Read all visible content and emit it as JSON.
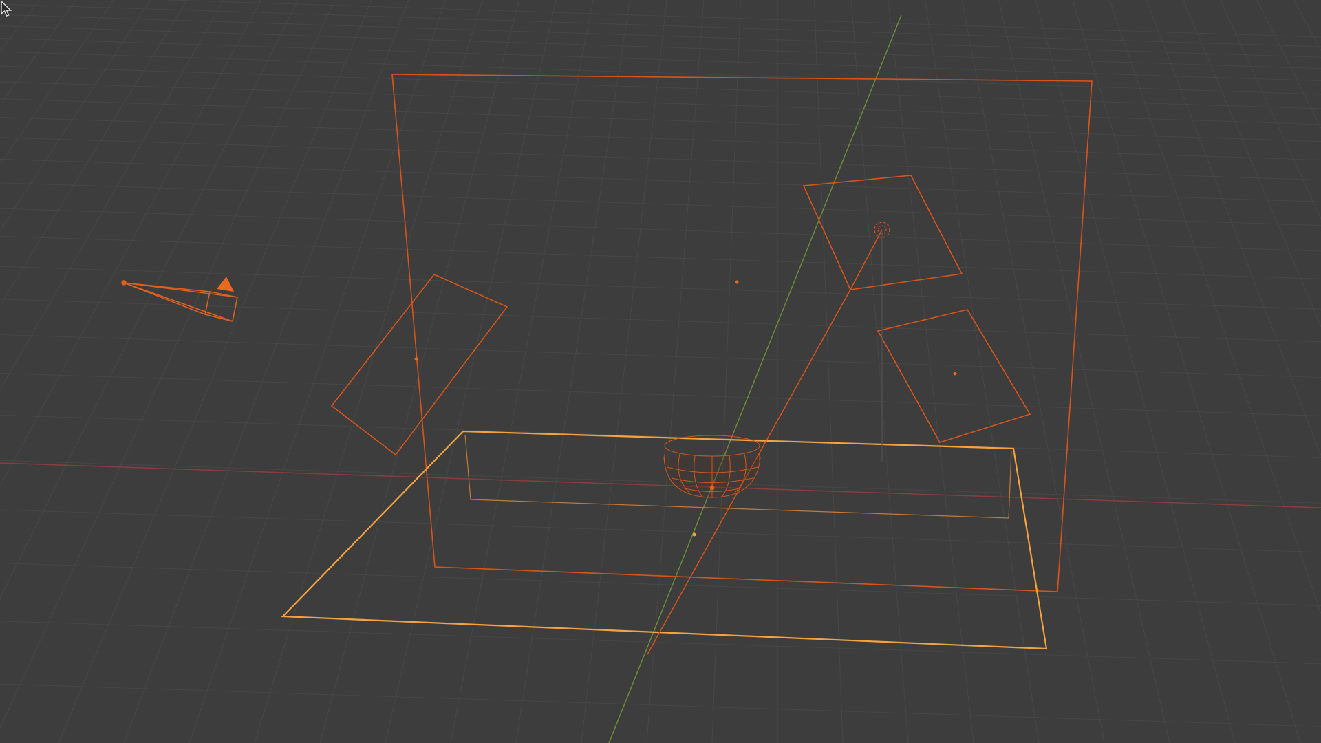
{
  "app": "3D Viewport",
  "viewport": {
    "background": "#3d3d3d",
    "grid_color": "#4a4a4a",
    "x_axis_color": "#9a4040",
    "y_axis_color": "#6a8a3a",
    "selected_color": "#e86a1e",
    "active_color": "#f5a340"
  },
  "objects": [
    {
      "name": "camera",
      "icon": "camera-icon",
      "selected": true
    },
    {
      "name": "backdrop-plane",
      "selected": true
    },
    {
      "name": "area-light-left",
      "icon": "area-light-icon",
      "selected": true
    },
    {
      "name": "area-light-top-right",
      "icon": "area-light-icon",
      "selected": true
    },
    {
      "name": "area-light-bottom-right",
      "icon": "area-light-icon",
      "selected": true
    },
    {
      "name": "spot-light",
      "icon": "spot-light-icon",
      "selected": true
    },
    {
      "name": "floor-plane",
      "selected": true,
      "active": true
    },
    {
      "name": "bowl-mesh",
      "selected": true
    }
  ],
  "cursor": {
    "icon": "mouse-pointer-icon"
  }
}
